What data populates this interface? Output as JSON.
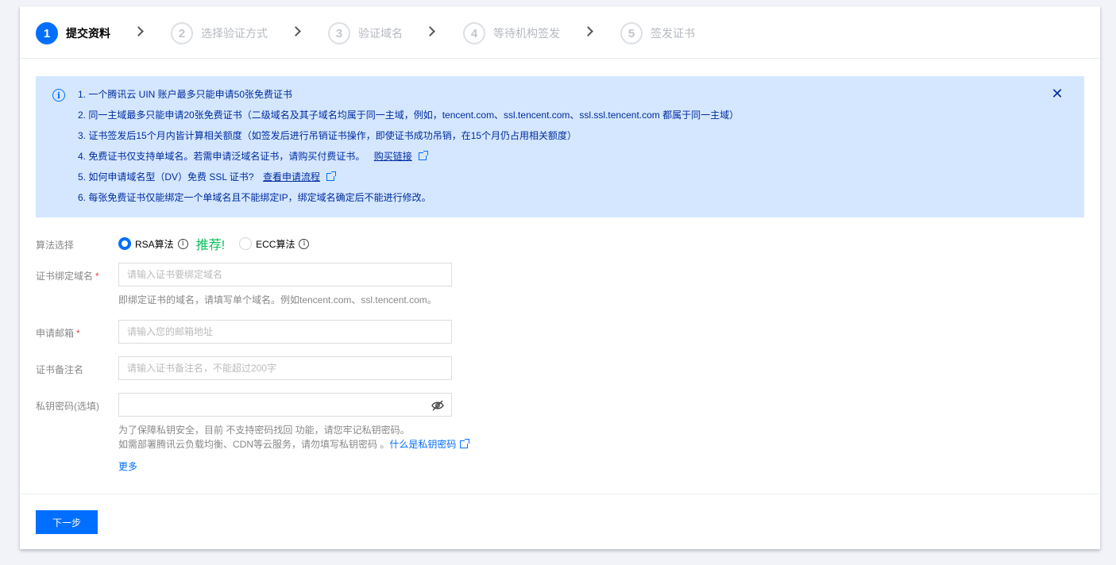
{
  "steps": [
    {
      "num": "1",
      "label": "提交资料"
    },
    {
      "num": "2",
      "label": "选择验证方式"
    },
    {
      "num": "3",
      "label": "验证域名"
    },
    {
      "num": "4",
      "label": "等待机构签发"
    },
    {
      "num": "5",
      "label": "签发证书"
    }
  ],
  "notice": {
    "lines": [
      "1. 一个腾讯云 UIN 账户最多只能申请50张免费证书",
      "2. 同一主域最多只能申请20张免费证书（二级域名及其子域名均属于同一主域，例如，tencent.com、ssl.tencent.com、ssl.ssl.tencent.com 都属于同一主域）",
      "3. 证书签发后15个月内皆计算相关额度（如签发后进行吊销证书操作，即使证书成功吊销，在15个月仍占用相关额度）",
      "4. 免费证书仅支持单域名。若需申请泛域名证书，请购买付费证书。",
      "5. 如何申请域名型（DV）免费 SSL 证书?",
      "6. 每张免费证书仅能绑定一个单域名且不能绑定IP，绑定域名确定后不能进行修改。"
    ],
    "buy_link": "购买链接",
    "process_link": "查看申请流程"
  },
  "form": {
    "algo_label": "算法选择",
    "rsa_label": "RSA算法",
    "recommend": "推荐!",
    "ecc_label": "ECC算法",
    "domain_label": "证书绑定域名",
    "domain_placeholder": "请输入证书要绑定域名",
    "domain_hint": "即绑定证书的域名，请填写单个域名。例如tencent.com、ssl.tencent.com。",
    "email_label": "申请邮箱",
    "email_placeholder": "请输入您的邮箱地址",
    "remark_label": "证书备注名",
    "remark_placeholder": "请输入证书备注名，不能超过200字",
    "key_label": "私钥密码(选填)",
    "key_hint_1": "为了保障私钥安全，目前 不支持密码找回 功能，请您牢记私钥密码。",
    "key_hint_2": "如需部署腾讯云负载均衡、CDN等云服务，请勿填写私钥密码 。",
    "key_link": "什么是私钥密码",
    "more": "更多",
    "required_mark": "*"
  },
  "footer": {
    "next_label": "下一步"
  },
  "colors": {
    "primary": "#006eff",
    "notice_bg": "#d5e7ff",
    "notice_text": "#002da0",
    "recommend": "#0abf5b",
    "required": "#e54545"
  }
}
